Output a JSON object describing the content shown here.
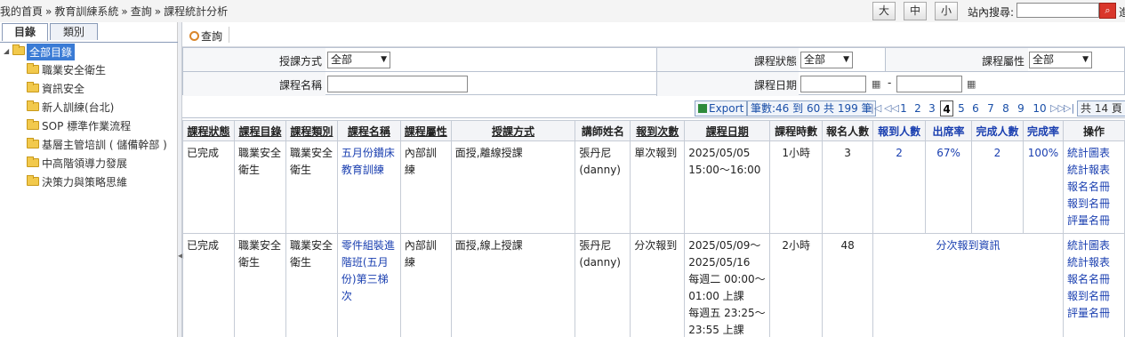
{
  "breadcrumb": [
    "我的首頁",
    "教育訓練系統",
    "查詢",
    "課程統計分析"
  ],
  "breadcrumb_sep": "»",
  "font_size_buttons": [
    "大",
    "中",
    "小"
  ],
  "site_search": {
    "label": "站內搜尋:",
    "value": "",
    "more": "進"
  },
  "left_tabs": [
    "目錄",
    "類別"
  ],
  "tree": {
    "root": "全部目錄",
    "items": [
      "職業安全衛生",
      "資訊安全",
      "新人訓練(台北)",
      "SOP 標準作業流程",
      "基層主管培訓 ( 儲備幹部 )",
      "中高階領導力發展",
      "決策力與策略思維"
    ]
  },
  "toolbar": {
    "query_label": "查詢"
  },
  "filters": {
    "teaching_method": {
      "label": "授課方式",
      "value": "全部"
    },
    "course_status": {
      "label": "課程狀態",
      "value": "全部"
    },
    "course_attribute": {
      "label": "課程屬性",
      "value": "全部"
    },
    "course_name": {
      "label": "課程名稱",
      "value": ""
    },
    "course_date": {
      "label": "課程日期",
      "from": "",
      "dash": "-",
      "to": ""
    }
  },
  "pager": {
    "export_label": "Export",
    "info": "筆數:46 到 60 共 199 筆",
    "pages": [
      "1",
      "2",
      "3",
      "4",
      "5",
      "6",
      "7",
      "8",
      "9",
      "10"
    ],
    "current": "4",
    "total": "共 14 頁"
  },
  "columns": [
    "課程狀態",
    "課程目錄",
    "課程類別",
    "課程名稱",
    "課程屬性",
    "授課方式",
    "講師姓名",
    "報到次數",
    "課程日期",
    "課程時數",
    "報名人數",
    "報到人數",
    "出席率",
    "完成人數",
    "完成率",
    "操作"
  ],
  "rows": [
    {
      "status": "已完成",
      "catalog": "職業安全衛生",
      "category": "職業安全衛生",
      "name": "五月份鑽床教育訓練",
      "attribute": "內部訓練",
      "method": "面授,離線授課",
      "teacher": "張丹尼(danny)",
      "checkin_type": "單次報到",
      "date": "2025/05/05 15:00～16:00",
      "hours": "1小時",
      "enrolled": "3",
      "checked_in": "2",
      "attendance": "67%",
      "completed": "2",
      "completion": "100%",
      "ops": [
        "統計圖表",
        "統計報表",
        "報名名冊",
        "報到名冊",
        "評量名冊"
      ]
    },
    {
      "status": "已完成",
      "catalog": "職業安全衛生",
      "category": "職業安全衛生",
      "name": "零件組裝進階班(五月份)第三梯次",
      "attribute": "內部訓練",
      "method": "面授,線上授課",
      "teacher": "張丹尼(danny)",
      "checkin_type": "分次報到",
      "date_lines": [
        "2025/05/09～",
        "2025/05/16",
        "每週二 00:00～",
        "01:00 上課",
        "每週五 23:25～",
        "23:55 上課"
      ],
      "hours": "2小時",
      "enrolled": "48",
      "multi_checkin_info": "分次報到資訊",
      "ops": [
        "統計圖表",
        "統計報表",
        "報名名冊",
        "報到名冊",
        "評量名冊"
      ]
    }
  ]
}
